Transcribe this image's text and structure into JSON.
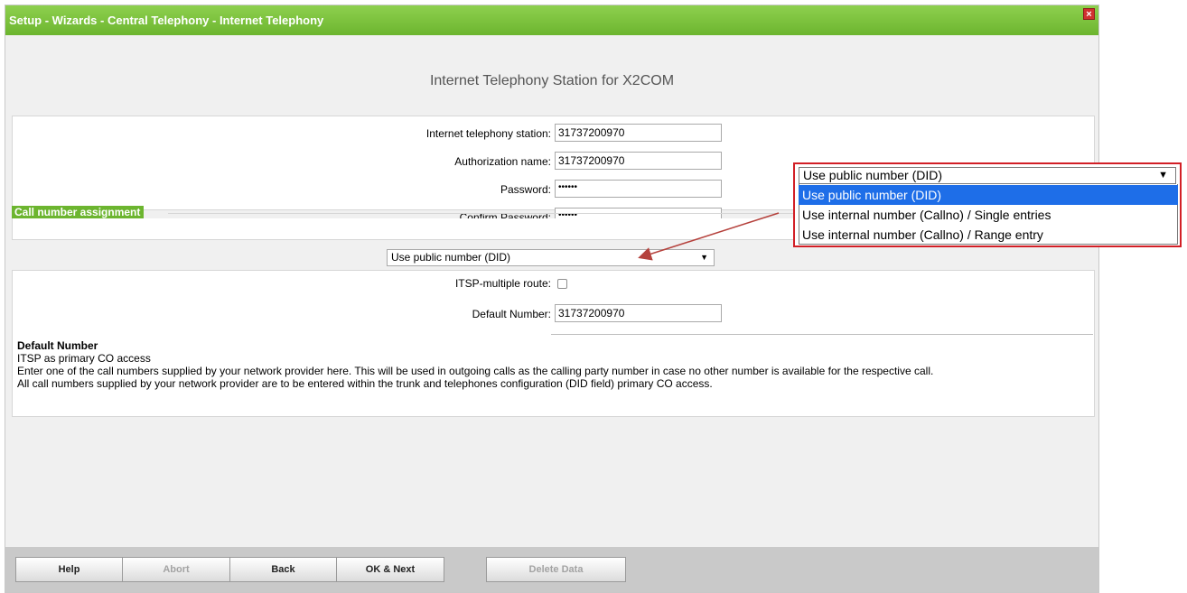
{
  "window": {
    "title": "Setup - Wizards - Central Telephony - Internet Telephony",
    "close_glyph": "×"
  },
  "heading": "Internet Telephony Station for X2COM",
  "form": {
    "station_label": "Internet telephony station:",
    "station_value": "31737200970",
    "auth_label": "Authorization name:",
    "auth_value": "31737200970",
    "password_label": "Password:",
    "password_value": "••••••",
    "confirm_label": "Confirm Password:",
    "confirm_value": "••••••"
  },
  "section": {
    "title": "Call number assignment",
    "select_value": "Use public number (DID)",
    "select_arrow": "▼"
  },
  "options": {
    "multiple_route_label": "ITSP-multiple route:",
    "multiple_route_checked": false,
    "default_number_label": "Default Number:",
    "default_number_value": "31737200970"
  },
  "help": {
    "title": "Default Number",
    "line1": "ITSP as primary CO access",
    "line2": "Enter one of the call numbers supplied by your network provider here. This will be used in outgoing calls as the calling party number in case no other number is available for the respective call.",
    "line3": "All call numbers supplied by your network provider are to be entered within the trunk and telephones configuration (DID field) primary CO access."
  },
  "buttons": {
    "help": "Help",
    "abort": "Abort",
    "back": "Back",
    "ok_next": "OK & Next",
    "delete_data": "Delete Data"
  },
  "dropdown_callout": {
    "current": "Use public number (DID)",
    "arrow": "▼",
    "options": [
      "Use public number (DID)",
      "Use internal number (Callno) / Single entries",
      "Use internal number (Callno) / Range entry"
    ],
    "selected_index": 0
  },
  "colors": {
    "title_bar": "#6cb52f",
    "callout_border": "#d21f26",
    "selection": "#1e6ee8"
  }
}
